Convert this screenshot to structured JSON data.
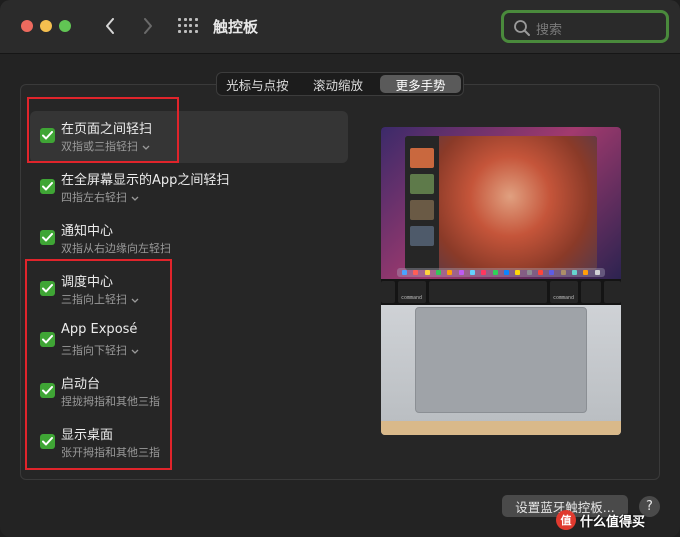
{
  "window": {
    "title": "触控板"
  },
  "search": {
    "placeholder": "搜索"
  },
  "tabs": [
    {
      "label": "光标与点按"
    },
    {
      "label": "滚动缩放"
    },
    {
      "label": "更多手势"
    }
  ],
  "gestures": [
    {
      "title": "在页面之间轻扫",
      "desc": "双指或三指轻扫",
      "dropdown": true
    },
    {
      "title": "在全屏幕显示的App之间轻扫",
      "desc": "四指左右轻扫",
      "dropdown": true
    },
    {
      "title": "通知中心",
      "desc": "双指从右边缘向左轻扫",
      "dropdown": false
    },
    {
      "title": "调度中心",
      "desc": "三指向上轻扫",
      "dropdown": true
    },
    {
      "title": "App Exposé",
      "desc": "三指向下轻扫",
      "dropdown": true
    },
    {
      "title": "启动台",
      "desc": "捏拢拇指和其他三指",
      "dropdown": false
    },
    {
      "title": "显示桌面",
      "desc": "张开拇指和其他三指",
      "dropdown": false
    }
  ],
  "preview": {
    "key_left": "command",
    "key_right": "command"
  },
  "footer": {
    "bluetooth_button": "设置蓝牙触控板...",
    "help": "?"
  },
  "watermark": {
    "logo": "值",
    "text": "什么值得买"
  },
  "colors": {
    "checkbox": "#3fa535",
    "highlight": "#e0242b",
    "search_ring": "#4a8a3c"
  }
}
